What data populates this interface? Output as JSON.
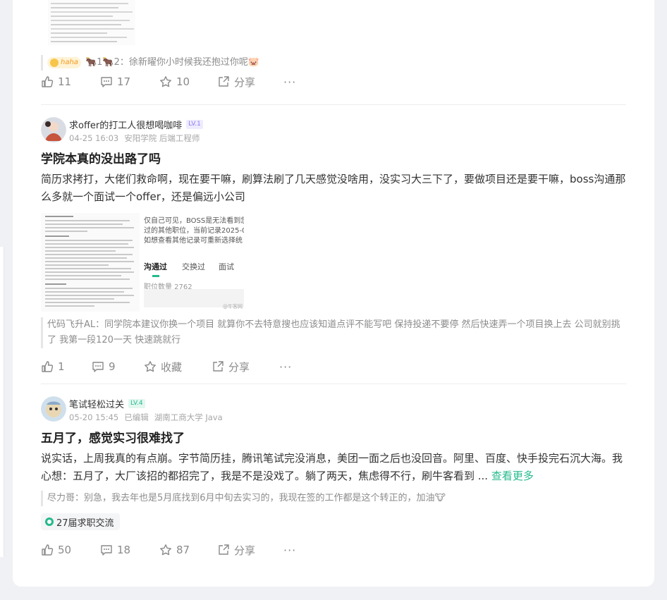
{
  "top_post": {
    "comment": {
      "badge": "haha",
      "text": "🐂1🐂2：徐新曜你小时候我还抱过你呢🐷"
    },
    "actions": {
      "likes": "11",
      "comments": "17",
      "stars": "10",
      "share": "分享",
      "more": "···"
    }
  },
  "posts": [
    {
      "author": "求offer的打工人很想喝咖啡",
      "level": "LV.1",
      "time": "04-25 16:03",
      "meta": "安阳学院 后端工程师",
      "title": "学院本真的没出路了吗",
      "body": "简历求拷打，大佬们救命啊，现在要干嘛，刷算法刷了几天感觉没啥用，没实习大三下了，要做项目还是要干嘛，boss沟通那么多就一个面试一个offer，还是偏远小公司",
      "image2": {
        "line1": "仅自己可见，BOSS是无法看到您",
        "line2": "过的其他职位，当前记录2025-0",
        "line3": "如想查看其他记录可重新选择统",
        "tab_active": "沟通过",
        "tab2": "交换过",
        "tab3": "面试",
        "count": "职位数量 2762",
        "watermark": "@牛客网"
      },
      "comment": "代码飞升AL：同学院本建议你换一个项目 就算你不去特意搜也应该知道点评不能写吧 保持投递不要停 然后快速弄一个项目换上去 公司就别挑了 我第一段120一天 快速跳就行",
      "actions": {
        "likes": "1",
        "comments": "9",
        "stars": "收藏",
        "share": "分享",
        "more": "···"
      }
    },
    {
      "author": "笔试轻松过关",
      "level": "LV.4",
      "time": "05-20 15:45",
      "edited": "已编辑",
      "meta": "湖南工商大学 Java",
      "title": "五月了，感觉实习很难找了",
      "body": "说实话，上周我真的有点崩。字节简历挂，腾讯笔试完没消息，美团一面之后也没回音。阿里、百度、快手投完石沉大海。我心想：五月了，大厂该招的都招完了，我是不是没戏了。躺了两天，焦虑得不行，刷牛客看到 ...",
      "see_more": "查看更多",
      "comment": "尽力哥：别急，我去年也是5月底找到6月中旬去实习的，我现在签的工作都是这个转正的，加油🐮",
      "tag": "27届求职交流",
      "actions": {
        "likes": "50",
        "comments": "18",
        "stars": "87",
        "share": "分享",
        "more": "···"
      }
    }
  ],
  "colors": {
    "accent": "#25b98b",
    "muted": "#8a8a8a",
    "level1": "#8a7cf0"
  }
}
